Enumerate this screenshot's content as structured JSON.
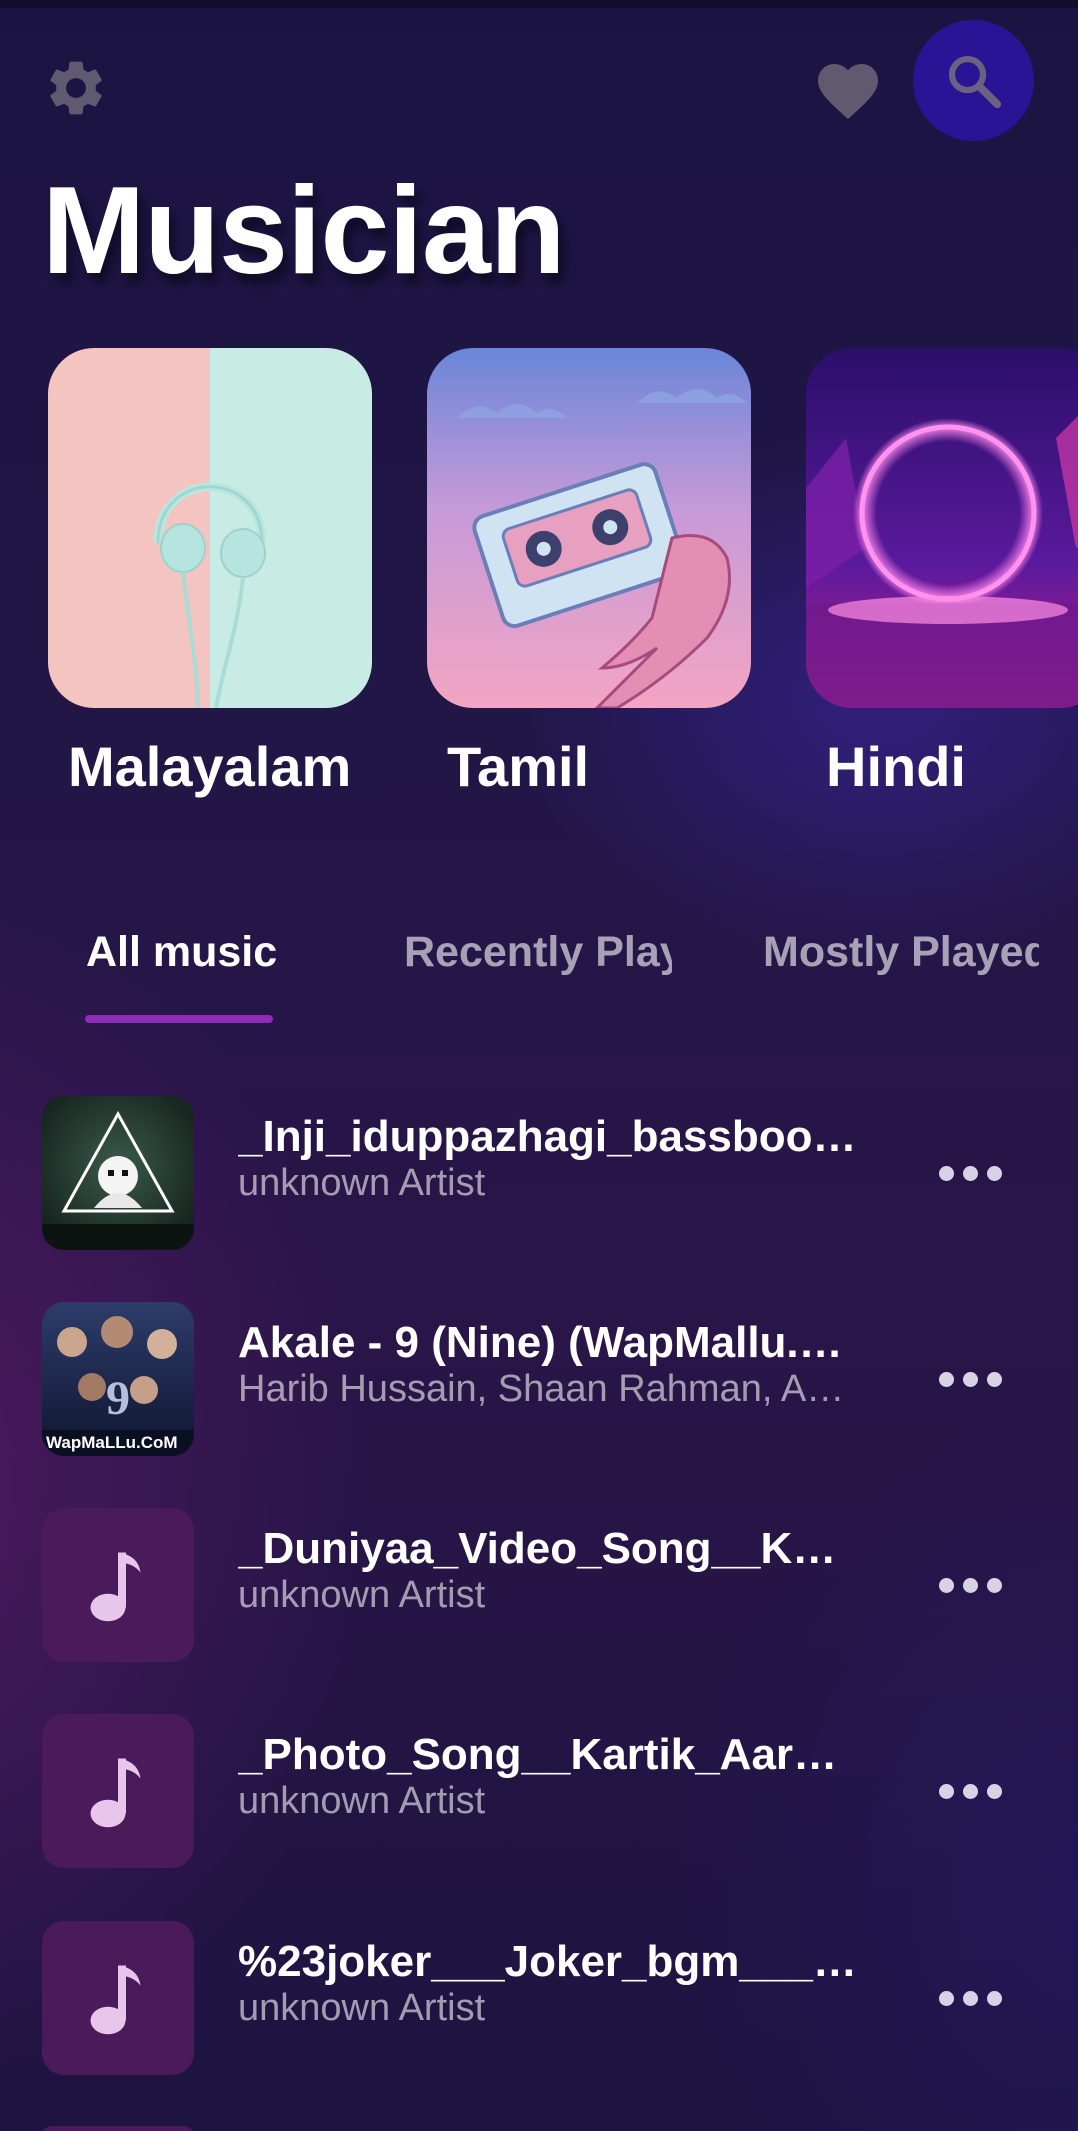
{
  "header": {
    "title": "Musician",
    "icons": {
      "settings": "gear-icon",
      "favorites": "heart-icon",
      "search": "search-icon"
    }
  },
  "categories": [
    {
      "label": "Malayalam",
      "art": "headphones-artwork"
    },
    {
      "label": "Tamil",
      "art": "cassette-artwork"
    },
    {
      "label": "Hindi",
      "art": "neon-ring-artwork"
    }
  ],
  "tabs": [
    {
      "label": "All music",
      "active": true
    },
    {
      "label": "Recently Played",
      "active": false
    },
    {
      "label": "Mostly Played",
      "active": false
    }
  ],
  "songs": [
    {
      "title": "_Inji_iduppazhagi_bassboote...",
      "artist": "unknown Artist",
      "thumb": "triangle-dj-art"
    },
    {
      "title": "Akale - 9 (Nine) (WapMallu.C...",
      "artist": "Harib Hussain, Shaan Rahman, An...",
      "thumb": "movie-poster-art",
      "thumb_caption": "WapMaLLu.CoM"
    },
    {
      "title": "_Duniyaa_Video_Song__Karti...",
      "artist": "unknown Artist",
      "thumb": "music-note-icon"
    },
    {
      "title": "_Photo_Song__Kartik_Aaryan...",
      "artist": "unknown Artist",
      "thumb": "music-note-icon"
    },
    {
      "title": "%23joker___Joker_bgm___Jo...",
      "artist": "unknown Artist",
      "thumb": "music-note-icon"
    }
  ],
  "colors": {
    "accent": "#8e2bb8",
    "search_button": "#2a1496",
    "background": "#1c1540"
  }
}
